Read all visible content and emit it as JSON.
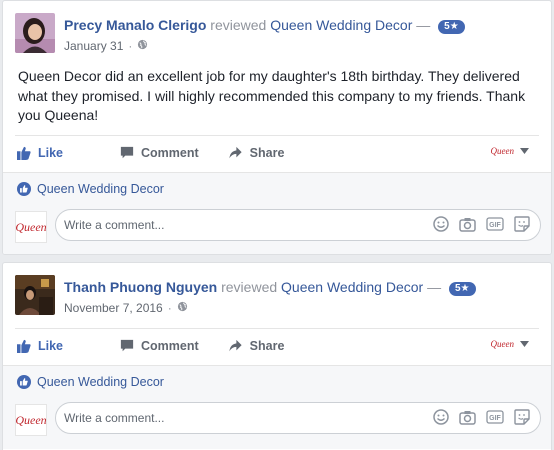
{
  "posts": [
    {
      "poster_name": "Precy Manalo Clerigo",
      "verb": "reviewed",
      "page_name": "Queen Wedding Decor",
      "separator": "—",
      "rating": "5★",
      "date": "January 31",
      "meta_dot": "·",
      "text": "Queen Decor did an excellent job for my daughter's 18th birthday. They delivered what they promised. I will highly recommended this company to my friends. Thank you Queena!",
      "actions": {
        "like": "Like",
        "comment": "Comment",
        "share": "Share"
      },
      "page_logo_text": "Queen",
      "liked_by": "Queen Wedding Decor",
      "comment_avatar_text": "Queen",
      "comment_placeholder": "Write a comment..."
    },
    {
      "poster_name": "Thanh Phuong Nguyen",
      "verb": "reviewed",
      "page_name": "Queen Wedding Decor",
      "separator": "—",
      "rating": "5★",
      "date": "November 7, 2016",
      "meta_dot": "·",
      "text": "",
      "actions": {
        "like": "Like",
        "comment": "Comment",
        "share": "Share"
      },
      "page_logo_text": "Queen",
      "liked_by": "Queen Wedding Decor",
      "comment_avatar_text": "Queen",
      "comment_placeholder": "Write a comment..."
    }
  ],
  "icons": {
    "like": "thumbs-up-icon",
    "comment": "speech-bubble-icon",
    "share": "share-arrow-icon",
    "caret": "caret-down-icon",
    "globe": "globe-icon",
    "emoji": "smiley-icon",
    "camera": "camera-icon",
    "gif": "gif-icon",
    "sticker": "sticker-icon"
  },
  "colors": {
    "link": "#365899",
    "like_blue": "#4267b2",
    "muted": "#90949c",
    "background": "#e9ebee",
    "brand_red": "#c0262d"
  }
}
